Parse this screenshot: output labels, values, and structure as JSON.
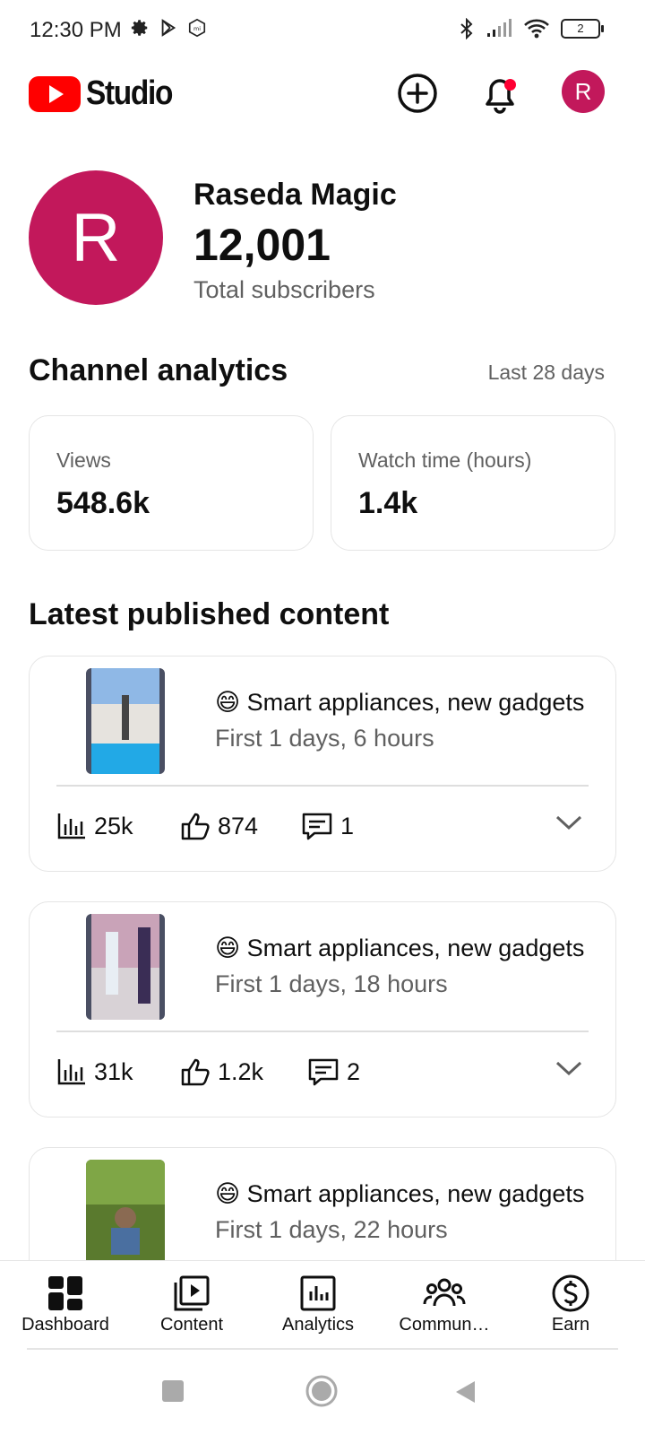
{
  "status_bar": {
    "time": "12:30 PM",
    "battery": "2",
    "icons": [
      "gear-icon",
      "play-store-icon",
      "mi-icon",
      "bluetooth-icon",
      "signal-icon",
      "wifi-icon",
      "battery-icon"
    ]
  },
  "header": {
    "logo_text": "Studio",
    "avatar_letter": "R",
    "brand_color": "#ff0000"
  },
  "channel": {
    "avatar_letter": "R",
    "avatar_color": "#c2185b",
    "name": "Raseda Magic",
    "subscriber_count": "12,001",
    "subscriber_label": "Total subscribers"
  },
  "analytics": {
    "title": "Channel analytics",
    "period": "Last 28 days",
    "cards": [
      {
        "label": "Views",
        "value": "548.6k"
      },
      {
        "label": "Watch time (hours)",
        "value": "1.4k"
      }
    ]
  },
  "latest": {
    "title": "Latest published content",
    "items": [
      {
        "title": "😄 Smart appliances, new gadgets",
        "age": "First 1 days, 6 hours",
        "views": "25k",
        "likes": "874",
        "comments": "1"
      },
      {
        "title": "😄 Smart appliances, new gadgets",
        "age": "First 1 days, 18 hours",
        "views": "31k",
        "likes": "1.2k",
        "comments": "2"
      },
      {
        "title": "😄 Smart appliances, new gadgets",
        "age": "First 1 days, 22 hours",
        "views": "",
        "likes": "",
        "comments": ""
      }
    ]
  },
  "bottom_nav": {
    "items": [
      {
        "label": "Dashboard",
        "icon": "dashboard-icon"
      },
      {
        "label": "Content",
        "icon": "content-icon"
      },
      {
        "label": "Analytics",
        "icon": "analytics-icon"
      },
      {
        "label": "Commun…",
        "icon": "community-icon"
      },
      {
        "label": "Earn",
        "icon": "earn-icon"
      }
    ]
  }
}
